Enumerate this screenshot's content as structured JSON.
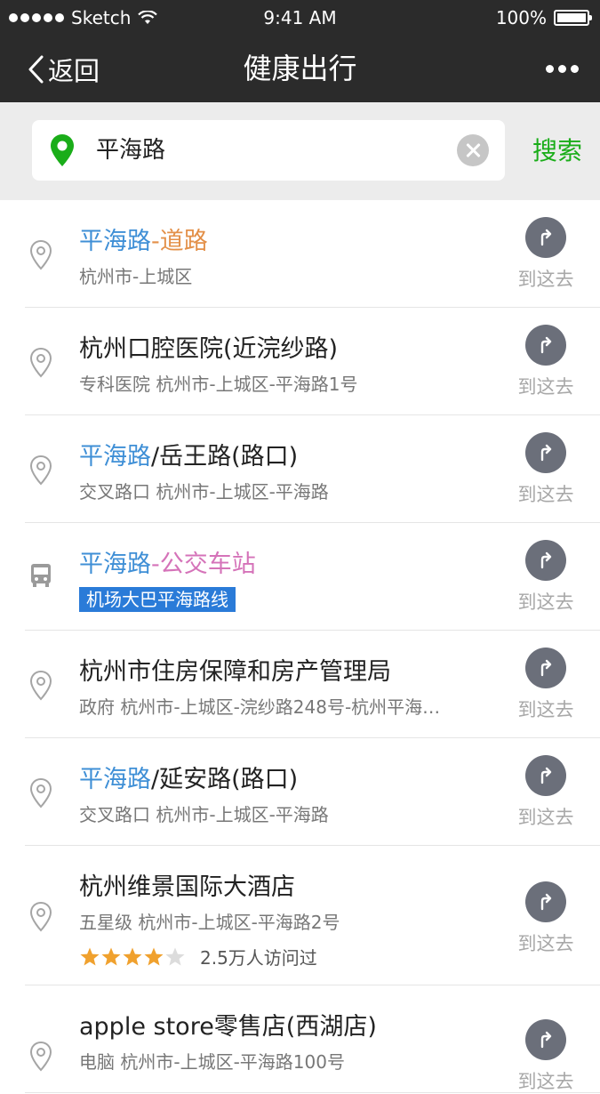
{
  "status_bar": {
    "carrier": "Sketch",
    "time": "9:41 AM",
    "battery": "100%"
  },
  "nav": {
    "back_label": "返回",
    "title": "健康出行"
  },
  "search": {
    "value": "平海路",
    "button_label": "搜索"
  },
  "results": [
    {
      "title_hl": "平海路",
      "title_rest": "-道路",
      "subtitle": "杭州市-上城区",
      "icon": "map-pin-icon",
      "action": "到这去"
    },
    {
      "title_hl": "",
      "title_rest": "杭州口腔医院(近浣纱路)",
      "subtitle": "专科医院  杭州市-上城区-平海路1号",
      "icon": "map-pin-icon",
      "action": "到这去"
    },
    {
      "title_hl": "平海路",
      "title_rest": "/岳王路(路口)",
      "subtitle": "交叉路口  杭州市-上城区-平海路",
      "icon": "map-pin-icon",
      "action": "到这去"
    },
    {
      "title_hl": "平海路",
      "title_rest": "-公交车站",
      "subtitle": "机场大巴平海路线",
      "icon": "bus-icon",
      "action": "到这去"
    },
    {
      "title_hl": "",
      "title_rest": "杭州市住房保障和房产管理局",
      "subtitle": "政府  杭州市-上城区-浣纱路248号-杭州平海…",
      "icon": "map-pin-icon",
      "action": "到这去"
    },
    {
      "title_hl": "平海路",
      "title_rest": "/延安路(路口)",
      "subtitle": "交叉路口  杭州市-上城区-平海路",
      "icon": "map-pin-icon",
      "action": "到这去"
    },
    {
      "title_hl": "",
      "title_rest": "杭州维景国际大酒店",
      "subtitle": "五星级  杭州市-上城区-平海路2号",
      "icon": "map-pin-icon",
      "action": "到这去",
      "rating": 4.5,
      "visits": "2.5万人访问过"
    },
    {
      "title_hl": "",
      "title_rest": "apple store零售店(西湖店)",
      "subtitle": "电脑  杭州市-上城区-平海路100号",
      "icon": "map-pin-icon",
      "action": "到这去"
    }
  ],
  "colors": {
    "accent_green": "#1aad19",
    "highlight_blue": "#3f8fd6",
    "road_orange": "#e39049",
    "bus_pink": "#d573b9",
    "nav_bg": "#2b2b2b"
  }
}
